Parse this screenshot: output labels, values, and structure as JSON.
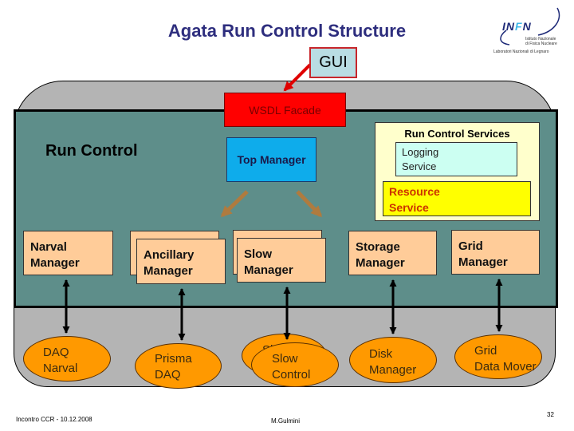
{
  "title": "Agata Run Control Structure",
  "logo": {
    "name_parts": [
      "IN",
      "F",
      "N"
    ],
    "line1": "Istituto Nazionale",
    "line2": "di Fisica Nucleare",
    "line3": "Laboratori Nazionali di Legnaro"
  },
  "gui": {
    "label": "GUI"
  },
  "wsdl_facade": {
    "label": "WSDL Facade"
  },
  "run_control": {
    "label": "Run Control"
  },
  "top_manager": {
    "label": "Top Manager"
  },
  "services": {
    "title": "Run Control Services",
    "logging": {
      "line1": "Logging",
      "line2": "Service"
    },
    "resource": {
      "line1": "Resource",
      "line2": "Service"
    }
  },
  "managers": [
    {
      "line1": "Narval",
      "line2": "Manager"
    },
    {
      "line1": "Ancillary",
      "line2": "Manager"
    },
    {
      "line1": "Slow",
      "line2": "Manager"
    },
    {
      "line1": "Storage",
      "line2": "Manager"
    },
    {
      "line1": "Grid",
      "line2": "Manager"
    }
  ],
  "components": [
    {
      "line1": "DAQ",
      "line2": "Narval"
    },
    {
      "line1": "Prisma",
      "line2": "DAQ"
    },
    {
      "line1": "Slow",
      "line2": "Control"
    },
    {
      "line1": "Disk",
      "line2": "Manager"
    },
    {
      "line1": "Grid",
      "line2": "Data Mover"
    }
  ],
  "footer": {
    "event": "Incontro CCR - 10.12.2008",
    "author": "M.Gulmini",
    "page": "32"
  },
  "colors": {
    "title": "#2E2E7E",
    "gray": "#B4B4B4",
    "teal": "#5E8E8A",
    "manager": "#FFCC99",
    "ellipse": "#FF9900",
    "top": "#0EACEB",
    "gui-bg": "#B9DDE3",
    "gui-border": "#C8262B",
    "wsdl": "#FF0000",
    "wsdl-text": "#7A0000",
    "services": "#FFFFCC",
    "logging": "#CCFFF2",
    "resource": "#FFFF00",
    "resource-text": "#CC3300",
    "brown": "#AF7B3F",
    "infn-blue": "#1E2A78",
    "infn-cyan": "#3FB8E8"
  }
}
